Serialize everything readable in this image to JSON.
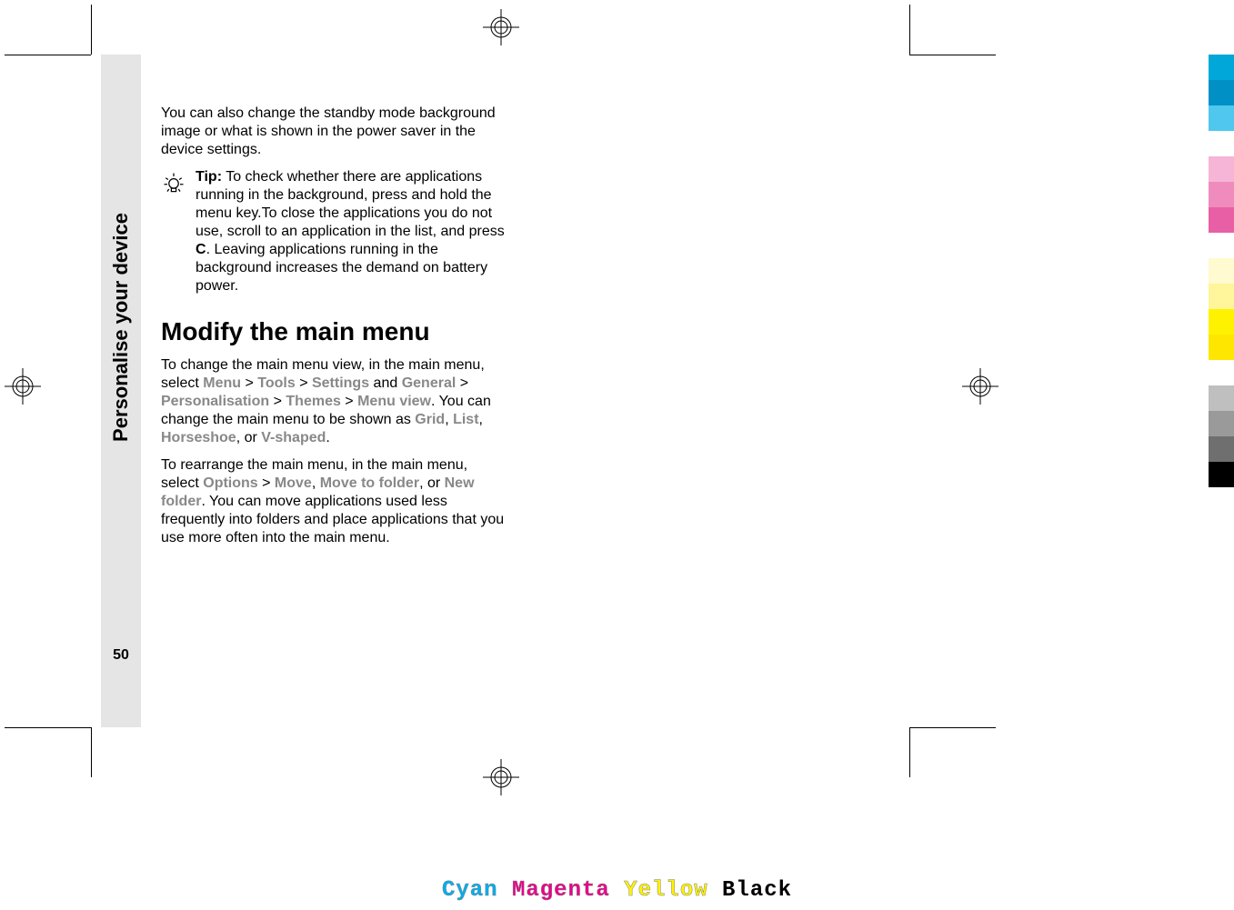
{
  "sideTab": {
    "label": "Personalise your device",
    "pageNumber": "50"
  },
  "body": {
    "intro": "You can also change the standby mode background image or what is shown in the power saver in the device settings.",
    "tip_label": "Tip:",
    "tip_body_1": " To check whether there are applications running in the background, press and hold the menu key.To close the applications you do not use, scroll to an application in the list, and press ",
    "tip_key": "C",
    "tip_body_2": ". Leaving applications running in the background increases the demand on battery power.",
    "heading": "Modify the main menu",
    "p2_a": "To change the main menu view, in the main menu, select ",
    "ui_menu": "Menu",
    "ui_tools": "Tools",
    "ui_settings": "Settings",
    "p2_b": " and ",
    "ui_general": "General",
    "ui_personalisation": "Personalisation",
    "ui_themes": "Themes",
    "ui_menuview": "Menu view",
    "p2_c": ". You can change the main menu to be shown as ",
    "ui_grid": "Grid",
    "ui_list": "List",
    "ui_horseshoe": "Horseshoe",
    "p2_d": ", or ",
    "ui_vshaped": "V-shaped",
    "p3_a": "To rearrange the main menu, in the main menu, select ",
    "ui_options": "Options",
    "ui_move": "Move",
    "ui_movetofolder": "Move to folder",
    "p3_b": ", or ",
    "ui_newfolder": "New folder",
    "p3_c": ". You can move applications used less frequently into folders and place applications that you use more often into the main menu.",
    "comma": ", ",
    "gt": " > ",
    "period": "."
  },
  "cmyk": {
    "cyan": "Cyan",
    "magenta": "Magenta",
    "yellow": "Yellow",
    "black": "Black"
  },
  "swatch_colors": [
    "#00a7d8",
    "#0090c6",
    "#4fc7ef",
    "#ffffff",
    "#f6b5d6",
    "#ef8bbd",
    "#e95fa5",
    "#ffffff",
    "#fffad0",
    "#fff59a",
    "#fff200",
    "#ffe600",
    "#ffffff",
    "#bfbfbf",
    "#9a9a9a",
    "#6f6f6f",
    "#000000"
  ]
}
